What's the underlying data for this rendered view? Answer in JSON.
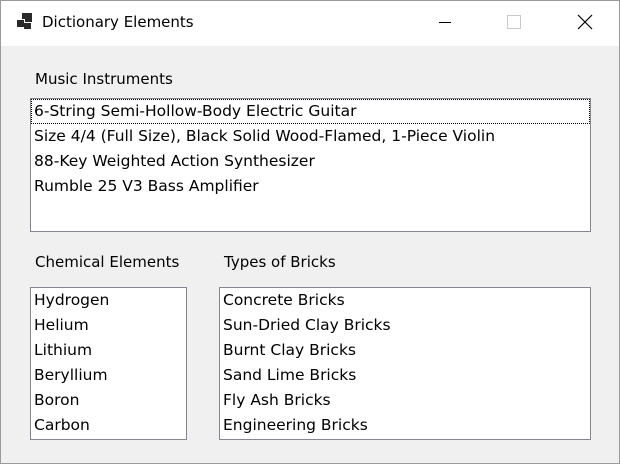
{
  "window": {
    "title": "Dictionary Elements",
    "icon": "window-stack-icon",
    "buttons": [
      "minimize-icon",
      "maximize-icon",
      "close-icon"
    ]
  },
  "instruments": {
    "label": "Music Instruments",
    "items": [
      "6-String Semi-Hollow-Body Electric Guitar",
      "Size 4/4 (Full Size), Black Solid Wood-Flamed, 1-Piece Violin",
      "88-Key Weighted Action Synthesizer",
      "Rumble 25 V3 Bass Amplifier"
    ]
  },
  "chemicals": {
    "label": "Chemical Elements",
    "items": [
      "Hydrogen",
      "Helium",
      "Lithium",
      "Beryllium",
      "Boron",
      "Carbon"
    ]
  },
  "bricks": {
    "label": "Types of Bricks",
    "items": [
      "Concrete Bricks",
      "Sun-Dried Clay Bricks",
      "Burnt Clay Bricks",
      "Sand Lime Bricks",
      "Fly Ash Bricks",
      "Engineering Bricks"
    ]
  }
}
